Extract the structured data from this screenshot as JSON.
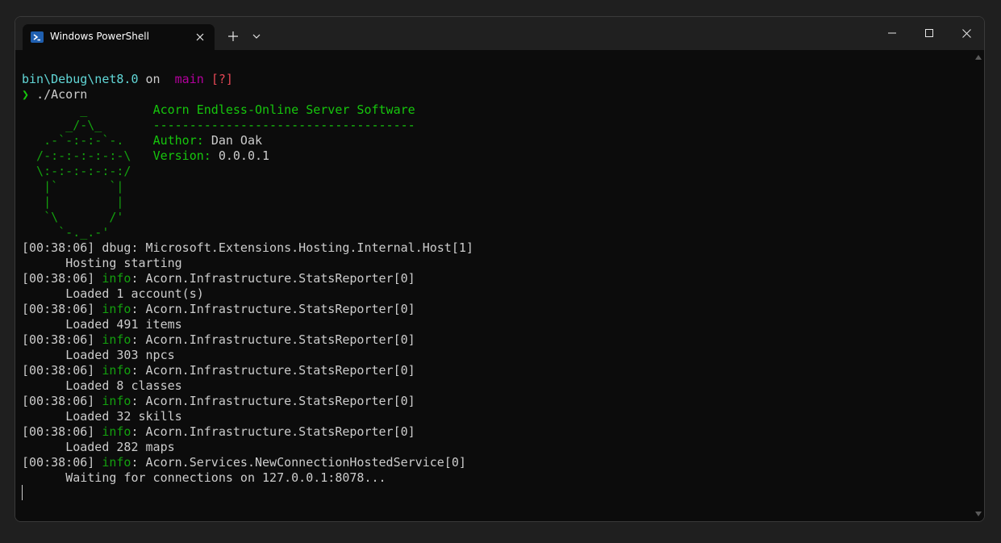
{
  "window": {
    "tab_title": "Windows PowerShell",
    "tab_icon": "powershell-icon",
    "new_tab_glyph": "+",
    "dropdown_glyph": "⌄",
    "minimize_glyph": "—",
    "maximize_glyph": "☐",
    "close_glyph": "✕"
  },
  "prompt": {
    "path": "bin\\Debug\\net8.0",
    "on": " on ",
    "branch_icon": "",
    "branch": "main",
    "status": "[?]",
    "chevron": "❯",
    "command": "./Acorn"
  },
  "banner": {
    "art": [
      "        _",
      "      _/-\\_",
      "   .-`-:-:-`-.",
      "  /-:-:-:-:-:-\\",
      "  \\:-:-:-:-:-:/",
      "   |`       `|",
      "   |         |",
      "   `\\       /'",
      "     `-._.-'"
    ],
    "title": "Acorn Endless-Online Server Software",
    "rule": "------------------------------------",
    "author_label": "Author:",
    "author": "Dan Oak",
    "version_label": "Version:",
    "version": "0.0.0.1"
  },
  "logs": [
    {
      "time": "[00:38:06]",
      "level": "dbug",
      "source": "Microsoft.Extensions.Hosting.Internal.Host[1]",
      "message": "Hosting starting"
    },
    {
      "time": "[00:38:06]",
      "level": "info",
      "source": "Acorn.Infrastructure.StatsReporter[0]",
      "message": "Loaded 1 account(s)"
    },
    {
      "time": "[00:38:06]",
      "level": "info",
      "source": "Acorn.Infrastructure.StatsReporter[0]",
      "message": "Loaded 491 items"
    },
    {
      "time": "[00:38:06]",
      "level": "info",
      "source": "Acorn.Infrastructure.StatsReporter[0]",
      "message": "Loaded 303 npcs"
    },
    {
      "time": "[00:38:06]",
      "level": "info",
      "source": "Acorn.Infrastructure.StatsReporter[0]",
      "message": "Loaded 8 classes"
    },
    {
      "time": "[00:38:06]",
      "level": "info",
      "source": "Acorn.Infrastructure.StatsReporter[0]",
      "message": "Loaded 32 skills"
    },
    {
      "time": "[00:38:06]",
      "level": "info",
      "source": "Acorn.Infrastructure.StatsReporter[0]",
      "message": "Loaded 282 maps"
    },
    {
      "time": "[00:38:06]",
      "level": "info",
      "source": "Acorn.Services.NewConnectionHostedService[0]",
      "message": "Waiting for connections on 127.0.0.1:8078..."
    }
  ]
}
